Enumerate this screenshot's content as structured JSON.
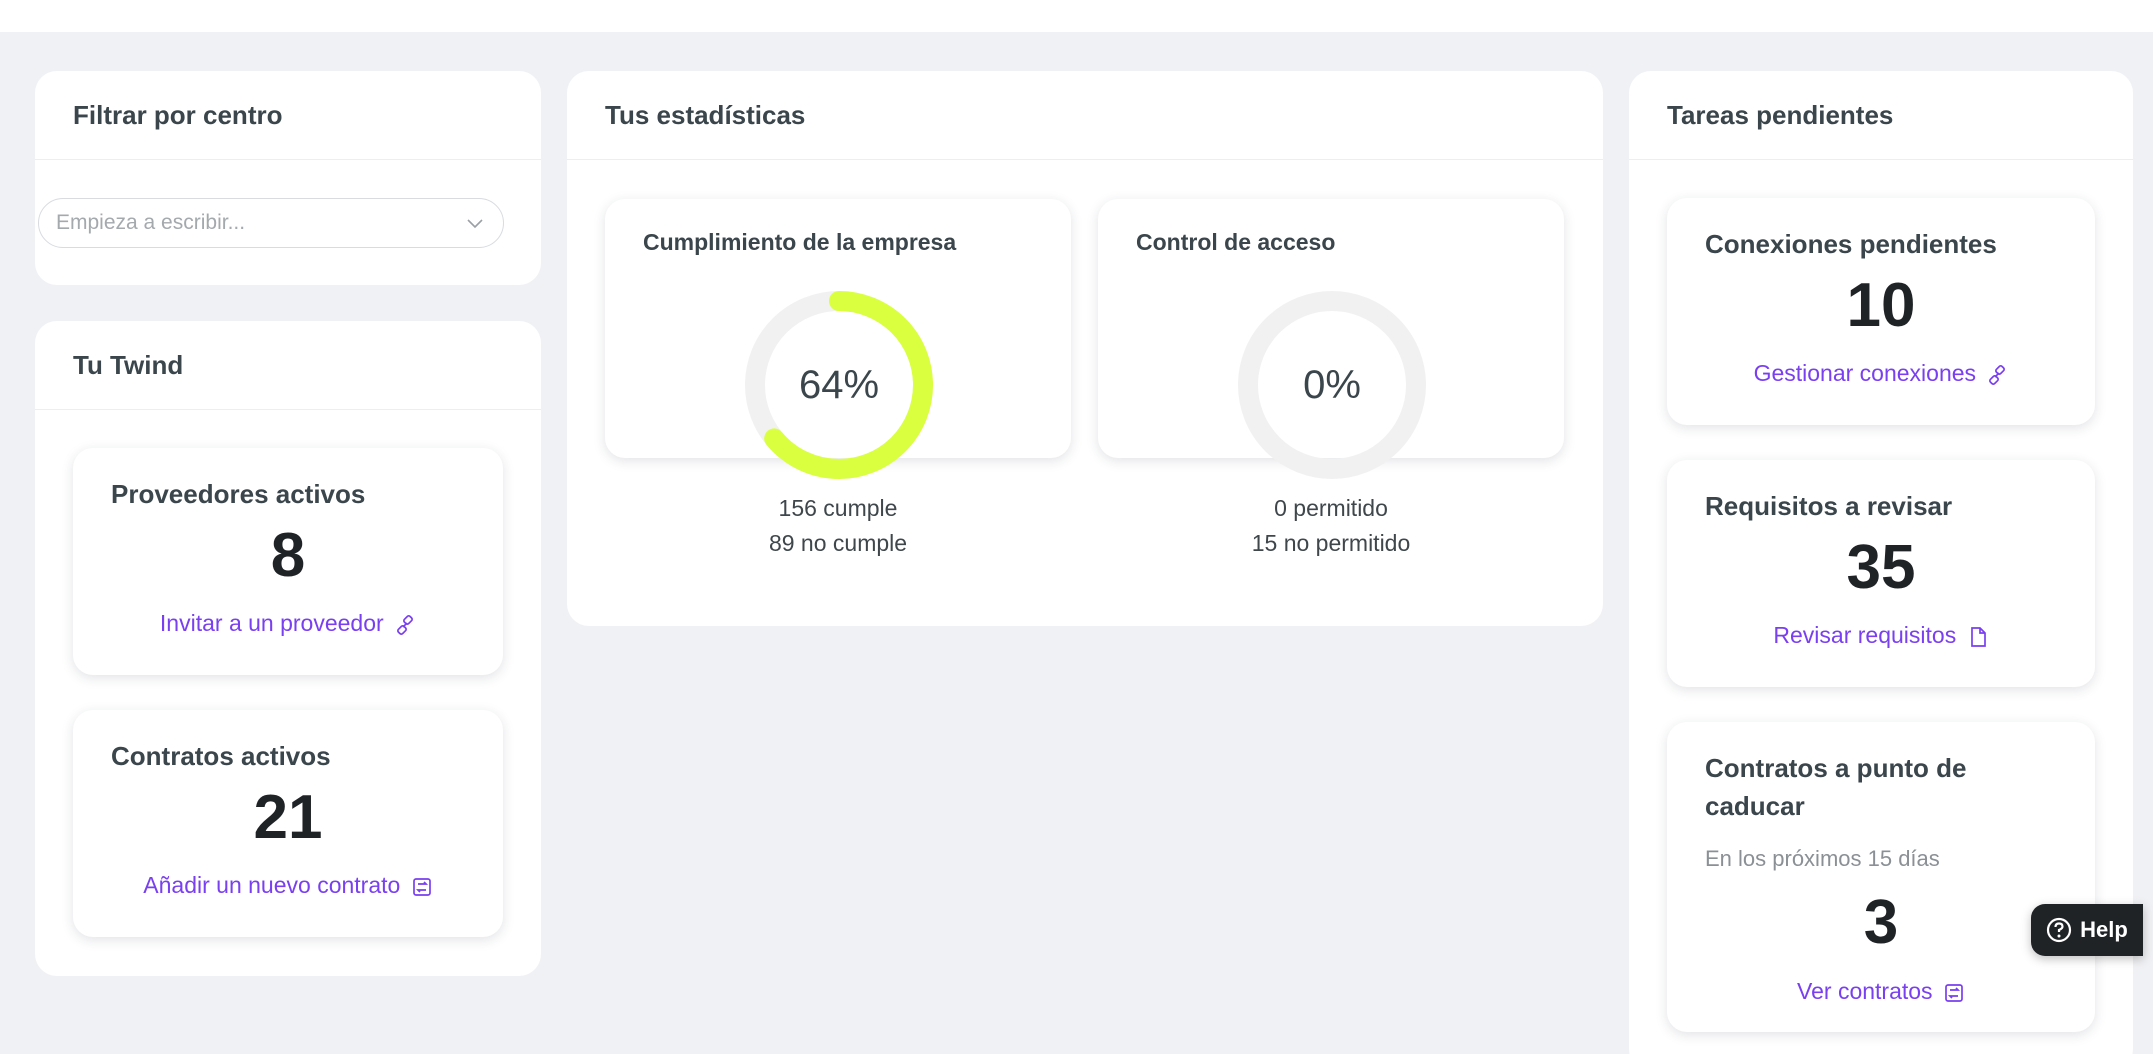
{
  "filter_panel": {
    "title": "Filtrar por centro",
    "search_placeholder": "Empieza a escribir..."
  },
  "twind_panel": {
    "title": "Tu Twind",
    "cards": [
      {
        "title": "Proveedores activos",
        "value": "8",
        "link": "Invitar a un proveedor",
        "link_icon": "link-icon"
      },
      {
        "title": "Contratos activos",
        "value": "21",
        "link": "Añadir un nuevo contrato",
        "link_icon": "contract-icon"
      }
    ]
  },
  "stats_panel": {
    "title": "Tus estadísticas",
    "charts": [
      {
        "title": "Cumplimiento de la empresa",
        "percent_label": "64%",
        "percent": 64,
        "line1": "156 cumple",
        "line2": "89 no cumple",
        "color": "#d9ff3f"
      },
      {
        "title": "Control de acceso",
        "percent_label": "0%",
        "percent": 0,
        "line1": "0 permitido",
        "line2": "15 no permitido",
        "color": "#d9ff3f"
      }
    ]
  },
  "tasks_panel": {
    "title": "Tareas pendientes",
    "cards": [
      {
        "title": "Conexiones pendientes",
        "value": "10",
        "link": "Gestionar conexiones",
        "link_icon": "link-icon"
      },
      {
        "title": "Requisitos a revisar",
        "value": "35",
        "link": "Revisar requisitos",
        "link_icon": "document-icon"
      },
      {
        "title": "Contratos a punto de caducar",
        "subtitle": "En los próximos 15 días",
        "value": "3",
        "link": "Ver contratos",
        "link_icon": "contract-icon"
      }
    ]
  },
  "help_button": {
    "label": "Help",
    "icon": "question-circle-icon"
  },
  "colors": {
    "accent": "#7a3ff0",
    "gauge": "#d9ff3f",
    "gauge_track": "#f1f1f1",
    "background": "#f0f1f4"
  }
}
